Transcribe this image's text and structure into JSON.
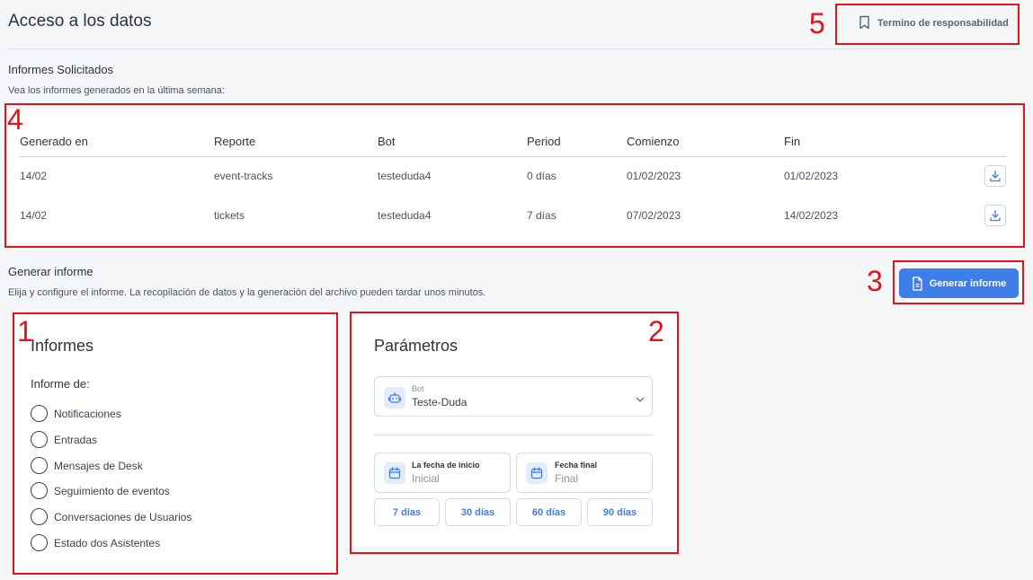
{
  "header": {
    "title": "Acceso a los datos",
    "terms_label": "Termino de responsabilidad"
  },
  "reports": {
    "title": "Informes Solicitados",
    "subtitle": "Vea los informes generados en la última semana:",
    "columns": [
      "Generado en",
      "Reporte",
      "Bot",
      "Period",
      "Comienzo",
      "Fin"
    ],
    "rows": [
      [
        "14/02",
        "event-tracks",
        "testeduda4",
        "0 días",
        "01/02/2023",
        "01/02/2023"
      ],
      [
        "14/02",
        "tickets",
        "testeduda4",
        "7 días",
        "07/02/2023",
        "14/02/2023"
      ]
    ]
  },
  "generate": {
    "title": "Generar informe",
    "subtitle": "Elija y configure el informe. La recopilación de datos y la generación del archivo pueden tardar unos minutos.",
    "button_label": "Generar informe"
  },
  "informes": {
    "title": "Informes",
    "group_label": "Informe de:",
    "options": [
      "Notificaciones",
      "Entradas",
      "Mensajes de Desk",
      "Seguimiento de eventos",
      "Conversaciones de Usuarios",
      "Estado dos Asistentes"
    ]
  },
  "parametros": {
    "title": "Parámetros",
    "bot_label": "Bot",
    "bot_value": "Teste-Duda",
    "start_label": "La fecha de inicio",
    "start_placeholder": "Inicial",
    "end_label": "Fecha final",
    "end_placeholder": "Final",
    "ranges": [
      "7 días",
      "30 días",
      "60 días",
      "90 días"
    ]
  },
  "annotations": [
    "1",
    "2",
    "3",
    "4",
    "5"
  ],
  "colors": {
    "accent": "#3f7de8",
    "annotation": "#e3131a",
    "background": "#f5f6f8"
  }
}
